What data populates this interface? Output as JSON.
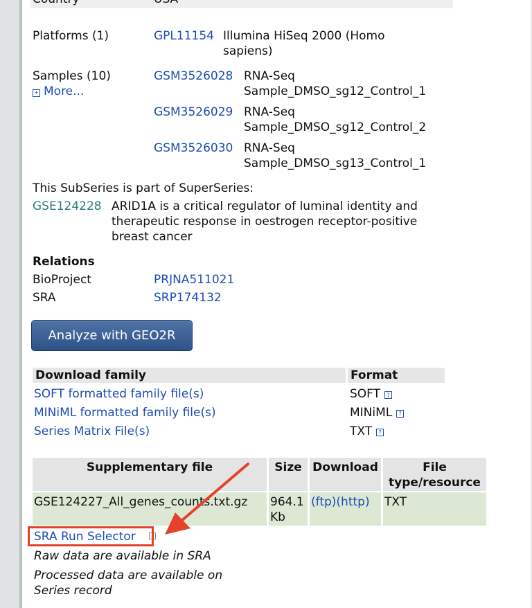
{
  "summary": {
    "country_label": "Country",
    "country_value": "USA",
    "platforms_label": "Platforms (1)",
    "platform_id": "GPL11154",
    "platform_name_line1": "Illumina HiSeq 2000 (Homo",
    "platform_name_line2": "sapiens)",
    "samples_label": "Samples (10)",
    "more_label": "More...",
    "samples": [
      {
        "id": "GSM3526028",
        "line1": "RNA-Seq",
        "line2": "Sample_DMSO_sg12_Control_1"
      },
      {
        "id": "GSM3526029",
        "line1": "RNA-Seq",
        "line2": "Sample_DMSO_sg12_Control_2"
      },
      {
        "id": "GSM3526030",
        "line1": "RNA-Seq",
        "line2": "Sample_DMSO_sg13_Control_1"
      }
    ]
  },
  "superseries": {
    "intro": "This SubSeries is part of SuperSeries:",
    "id": "GSE124228",
    "title_line1": "ARID1A is a critical regulator of luminal identity and",
    "title_line2": "therapeutic response in oestrogen receptor-positive",
    "title_line3": "breast cancer"
  },
  "relations": {
    "heading": "Relations",
    "bioproject_label": "BioProject",
    "bioproject_value": "PRJNA511021",
    "sra_label": "SRA",
    "sra_value": "SRP174132"
  },
  "geo2r_button": "Analyze with GEO2R",
  "download_family": {
    "header_name": "Download family",
    "header_format": "Format",
    "rows": [
      {
        "label": "SOFT formatted family file(s)",
        "format": "SOFT"
      },
      {
        "label": "MINiML formatted family file(s)",
        "format": "MINiML"
      },
      {
        "label": "Series Matrix File(s)",
        "format": "TXT"
      }
    ]
  },
  "supplementary": {
    "col_file": "Supplementary file",
    "col_size": "Size",
    "col_download": "Download",
    "col_type_line1": "File",
    "col_type_line2": "type/resource",
    "row": {
      "file": "GSE124227_All_genes_counts.txt.gz",
      "size_line1": "964.1",
      "size_line2": "Kb",
      "ftp": "(ftp)",
      "http": "(http)",
      "type": "TXT"
    }
  },
  "sra_run_selector": "SRA Run Selector",
  "notes": {
    "raw": "Raw data are available in SRA",
    "processed_line1": "Processed data are available on",
    "processed_line2": "Series record"
  },
  "colors": {
    "link": "#1d4db5",
    "teal_link": "#2a7e80",
    "annotation": "#e5422b",
    "button": "#2d5287"
  },
  "icons": {
    "more": "expand-plus-icon",
    "help": "help-question-icon",
    "external": "external-link-icon",
    "arrow": "red-annotation-arrow"
  }
}
